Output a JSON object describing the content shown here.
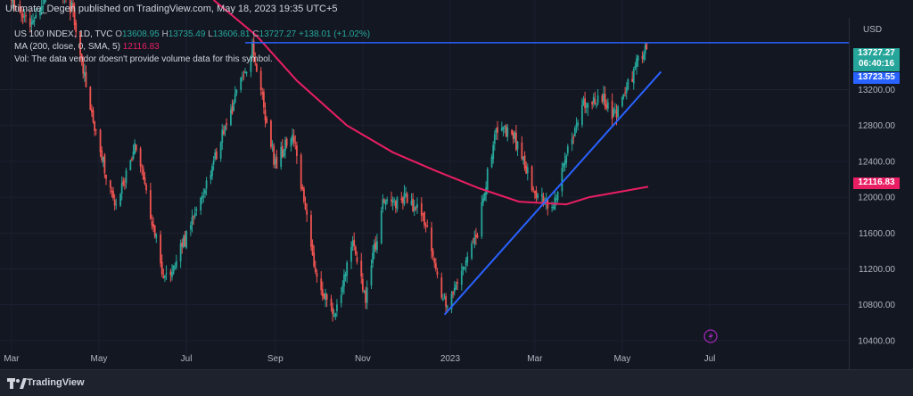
{
  "header": {
    "published": "Ultimate_Degen published on TradingView.com, May 18, 2023 19:35 UTC+5"
  },
  "legend": {
    "symbol": "US 100 INDEX, 1D, TVC",
    "o_label": "O",
    "o_value": "13608.95",
    "h_label": "H",
    "h_value": "13735.49",
    "l_label": "L",
    "l_value": "13606.81",
    "c_label": "C",
    "c_value": "13727.27",
    "change": "+138.01 (+1.02%)",
    "ma_label": "MA (200, close, 0, SMA, 5)",
    "ma_value": "12116.83",
    "vol_label": "Vol",
    "vol_message": "The data vendor doesn't provide volume data for this symbol."
  },
  "price_tags": {
    "current_price": "13727.27",
    "countdown": "06:40:16",
    "line_price": "13723.55",
    "ma_price": "12116.83",
    "currency": "USD"
  },
  "colors": {
    "up": "#26a69a",
    "down": "#ef5350",
    "ma": "#e91e63",
    "trendline": "#2962ff",
    "background": "#131722",
    "grid": "#1c2030"
  },
  "footer": {
    "brand": "TradingView",
    "logo_icon": "tradingview-logo-icon",
    "flash_icon": "lightning-icon"
  },
  "chart_data": {
    "type": "candlestick",
    "title": "US 100 INDEX, 1D, TVC",
    "x_tick_labels": [
      "Mar",
      "May",
      "Jul",
      "Sep",
      "Nov",
      "2023",
      "Mar",
      "May",
      "Jul"
    ],
    "y_ticks": [
      10400,
      10800,
      11200,
      11600,
      12000,
      12400,
      12800,
      13200
    ],
    "y_tick_labels": [
      "10400.00",
      "10800.00",
      "11200.00",
      "11600.00",
      "12000.00",
      "12400.00",
      "12800.00",
      "13200.00"
    ],
    "ylim": [
      10170,
      14200
    ],
    "x_range_days": [
      -7,
      585
    ],
    "grid": false,
    "price_path": [
      [
        "2022-03-01",
        14200
      ],
      [
        "2022-03-14",
        13900
      ],
      [
        "2022-03-29",
        14400
      ],
      [
        "2022-04-12",
        14100
      ],
      [
        "2022-04-28",
        12800
      ],
      [
        "2022-05-12",
        11850
      ],
      [
        "2022-05-27",
        12600
      ],
      [
        "2022-06-16",
        11050
      ],
      [
        "2022-07-01",
        11550
      ],
      [
        "2022-07-18",
        12300
      ],
      [
        "2022-08-02",
        13000
      ],
      [
        "2022-08-16",
        13650
      ],
      [
        "2022-09-01",
        12350
      ],
      [
        "2022-09-13",
        12750
      ],
      [
        "2022-09-30",
        11100
      ],
      [
        "2022-10-13",
        10690
      ],
      [
        "2022-10-25",
        11450
      ],
      [
        "2022-11-03",
        10900
      ],
      [
        "2022-11-15",
        11900
      ],
      [
        "2022-11-30",
        12000
      ],
      [
        "2022-12-13",
        11800
      ],
      [
        "2022-12-28",
        10800
      ],
      [
        "2023-01-06",
        11000
      ],
      [
        "2023-01-20",
        11600
      ],
      [
        "2023-02-02",
        12800
      ],
      [
        "2023-02-15",
        12650
      ],
      [
        "2023-03-02",
        12000
      ],
      [
        "2023-03-14",
        11900
      ],
      [
        "2023-03-24",
        12500
      ],
      [
        "2023-04-05",
        13050
      ],
      [
        "2023-04-17",
        13100
      ],
      [
        "2023-04-26",
        12900
      ],
      [
        "2023-05-05",
        13250
      ],
      [
        "2023-05-18",
        13727
      ]
    ],
    "ma_series": {
      "name": "MA (200, close, 0, SMA, 5)",
      "points": [
        [
          "2022-07-20",
          14200
        ],
        [
          "2022-08-19",
          13800
        ],
        [
          "2022-09-16",
          13300
        ],
        [
          "2022-10-21",
          12800
        ],
        [
          "2022-11-22",
          12500
        ],
        [
          "2022-12-21",
          12300
        ],
        [
          "2023-01-21",
          12100
        ],
        [
          "2023-02-18",
          11950
        ],
        [
          "2023-03-23",
          11920
        ],
        [
          "2023-04-08",
          12000
        ],
        [
          "2023-05-06",
          12080
        ],
        [
          "2023-05-19",
          12116.83
        ]
      ]
    },
    "horizontal_line": {
      "y": 13723.55,
      "from": "2022-08-11"
    },
    "trendline": {
      "from": [
        "2022-12-28",
        10690
      ],
      "to": [
        "2023-05-28",
        13400
      ]
    }
  }
}
